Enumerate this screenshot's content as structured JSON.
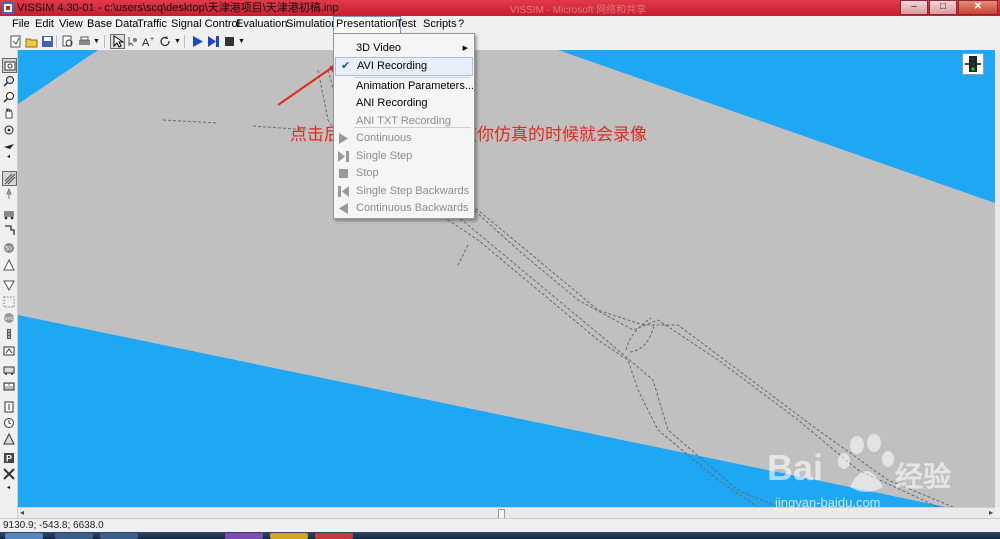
{
  "window": {
    "title": "VISSIM 4.30-01 - c:\\users\\scq\\desktop\\天津港项目\\天津港初稿.inp",
    "faded_text": "VISSIM - Microsoft 网络和共享",
    "buttons": {
      "minimize": "–",
      "maximize": "□",
      "close": "✕"
    }
  },
  "menubar": {
    "items": [
      "File",
      "Edit",
      "View",
      "Base Data",
      "Traffic",
      "Signal Control",
      "Evaluation",
      "Simulation",
      "Presentation",
      "Test",
      "Scripts",
      "?"
    ],
    "active": "Presentation"
  },
  "presentation_menu": {
    "items": [
      {
        "label": "3D Video",
        "enabled": true,
        "submenu": true
      },
      {
        "label": "AVI Recording",
        "enabled": true,
        "checked": true
      },
      {
        "label": "Animation Parameters...",
        "enabled": true
      },
      {
        "label": "ANI Recording",
        "enabled": true
      },
      {
        "label": "ANI TXT Recording",
        "enabled": false
      },
      {
        "label": "Continuous",
        "enabled": false,
        "icon": "play-icon"
      },
      {
        "label": "Single Step",
        "enabled": false,
        "icon": "step-icon"
      },
      {
        "label": "Stop",
        "enabled": false,
        "icon": "stop-icon"
      },
      {
        "label": "Single Step Backwards",
        "enabled": false,
        "icon": "step-back-icon"
      },
      {
        "label": "Continuous Backwards",
        "enabled": false,
        "icon": "play-back-icon"
      }
    ]
  },
  "annotation": {
    "text": "点击后就打上勾了证明在你仿真的时候就会录像",
    "color": "#e3281d"
  },
  "statusbar": {
    "coords": "9130.9; -543.8; 6638.0"
  },
  "watermark": {
    "brand": "Bai",
    "brand_cn": "经验",
    "url": "jingyan-baidu.com"
  },
  "colors": {
    "canvas_background": "#1ea7f5",
    "ground": "#c0c0c0",
    "titlebar": "#d42f3d"
  }
}
